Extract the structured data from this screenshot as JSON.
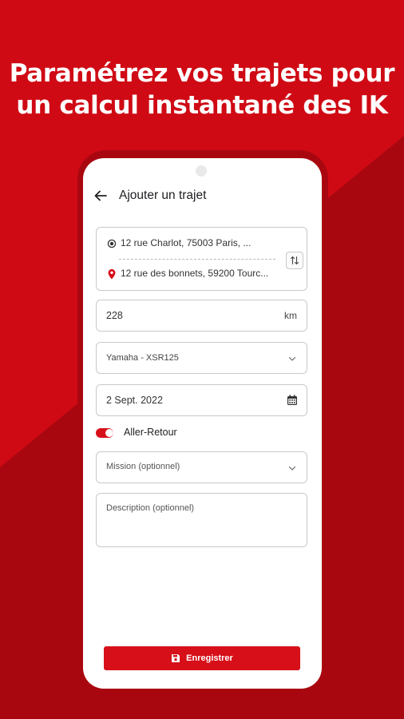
{
  "headline": {
    "line1": "Paramétrez vos trajets pour",
    "line2": "un calcul instantané des IK"
  },
  "colors": {
    "brand_red": "#cf0a14",
    "dark_red": "#a80710",
    "accent": "#d70f18"
  },
  "appbar": {
    "title": "Ajouter un trajet",
    "back_icon": "arrow-left-icon"
  },
  "route": {
    "origin": "12 rue Charlot, 75003 Paris, ...",
    "origin_icon": "radio-dot-icon",
    "destination": "12 rue des bonnets, 59200 Tourc...",
    "destination_icon": "map-pin-icon",
    "swap_icon": "swap-vertical-icon"
  },
  "distance": {
    "value": "228",
    "unit": "km"
  },
  "vehicle": {
    "value": "Yamaha - XSR125",
    "icon": "chevron-down-icon"
  },
  "date": {
    "value": "2 Sept. 2022",
    "icon": "calendar-icon"
  },
  "round_trip": {
    "label": "Aller-Retour",
    "enabled": true
  },
  "mission": {
    "placeholder": "Mission (optionnel)",
    "icon": "chevron-down-icon"
  },
  "description": {
    "placeholder": "Description (optionnel)"
  },
  "save": {
    "label": "Enregistrer",
    "icon": "floppy-disk-icon"
  }
}
